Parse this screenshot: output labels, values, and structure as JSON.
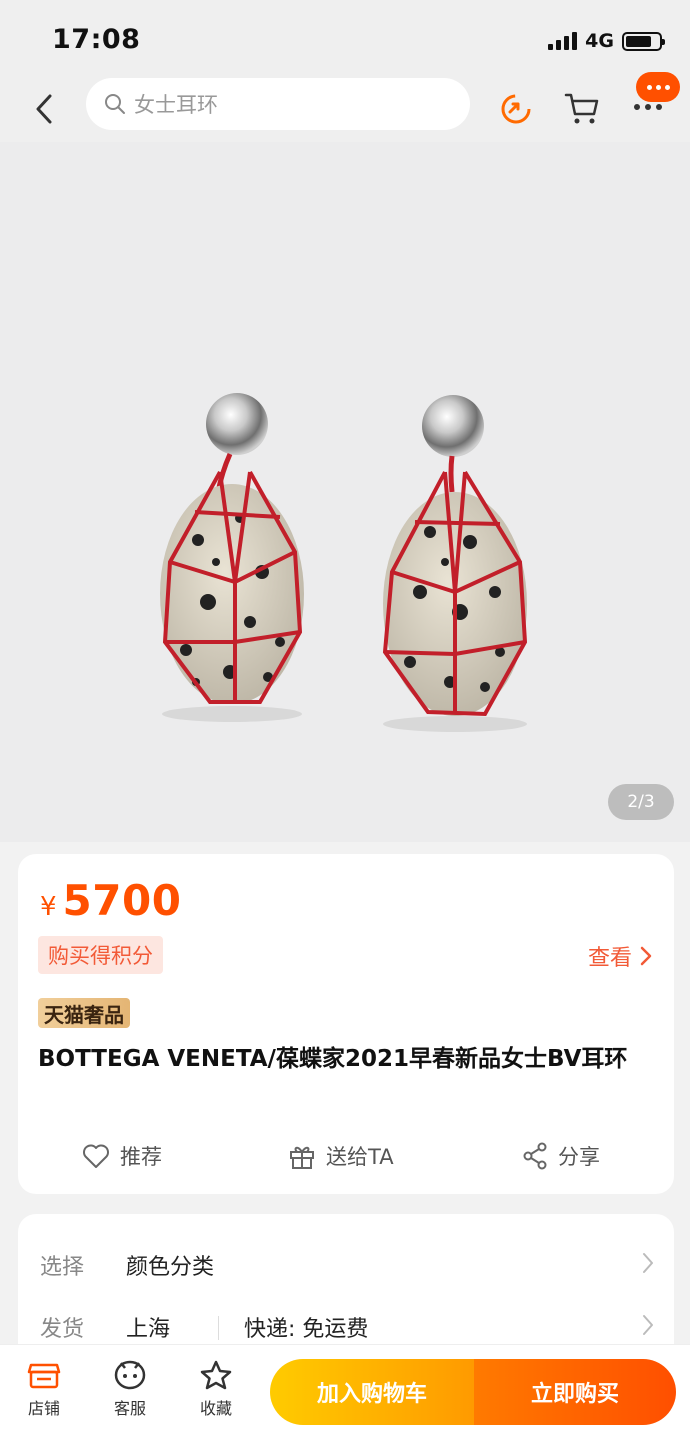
{
  "status_bar": {
    "time": "17:08",
    "network": "4G"
  },
  "nav": {
    "search_placeholder": "女士耳环",
    "icons": [
      "back-icon",
      "search-icon",
      "share-swirl-icon",
      "cart-icon",
      "message-icon",
      "more-icon"
    ]
  },
  "gallery": {
    "counter": "2/3"
  },
  "product": {
    "currency": "¥",
    "price": "5700",
    "points_label": "购买得积分",
    "view_label": "查看",
    "badge": "天猫奢品",
    "title": "BOTTEGA VENETA/葆蝶家2021早春新品女士BV耳环"
  },
  "actions": [
    {
      "label": "推荐",
      "icon": "heart-icon"
    },
    {
      "label": "送给TA",
      "icon": "gift-icon"
    },
    {
      "label": "分享",
      "icon": "share-icon"
    }
  ],
  "options": [
    {
      "label": "选择",
      "value": "颜色分类"
    },
    {
      "label": "发货",
      "value": "上海",
      "value2": "快递: 免运费"
    }
  ],
  "bottom_bar": {
    "tabs": [
      {
        "label": "店铺",
        "icon": "store-icon"
      },
      {
        "label": "客服",
        "icon": "customer-service-icon"
      },
      {
        "label": "收藏",
        "icon": "star-icon"
      }
    ],
    "add_to_cart": "加入购物车",
    "buy_now": "立即购买"
  },
  "colors": {
    "accent": "#ff5000",
    "cart_button": "#ffb300",
    "buy_button": "#ff5a00",
    "points_bg": "#fde6e0"
  }
}
